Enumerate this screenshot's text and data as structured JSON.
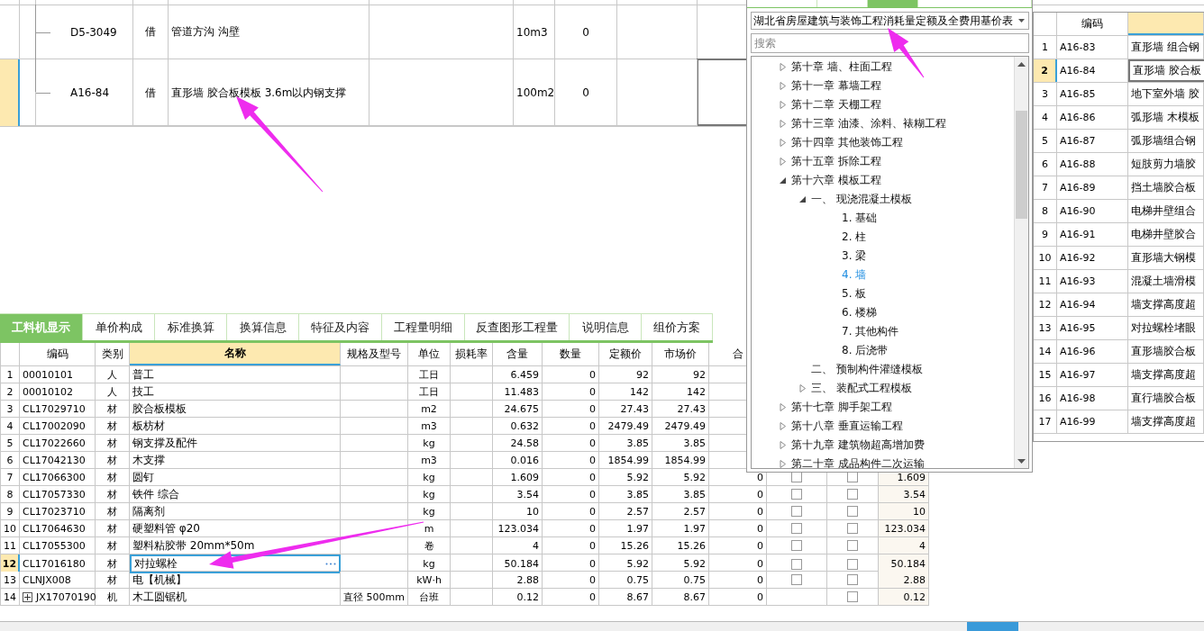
{
  "top_grid": {
    "rows": [
      {
        "code": "D5-3049",
        "type": "借",
        "name": "管道方沟 沟壁",
        "unit": "10m3",
        "qty": "0",
        "selected": false
      },
      {
        "code": "A16-84",
        "type": "借",
        "name": "直形墙 胶合板模板 3.6m以内钢支撑",
        "unit": "100m2",
        "qty": "0",
        "selected": true
      }
    ]
  },
  "tabs": [
    {
      "label": "工料机显示",
      "selected": true
    },
    {
      "label": "单价构成",
      "selected": false
    },
    {
      "label": "标准换算",
      "selected": false
    },
    {
      "label": "换算信息",
      "selected": false
    },
    {
      "label": "特征及内容",
      "selected": false
    },
    {
      "label": "工程量明细",
      "selected": false
    },
    {
      "label": "反查图形工程量",
      "selected": false
    },
    {
      "label": "说明信息",
      "selected": false
    },
    {
      "label": "组价方案",
      "selected": false
    }
  ],
  "resource_grid": {
    "columns": [
      "编码",
      "类别",
      "名称",
      "规格及型号",
      "单位",
      "损耗率",
      "含量",
      "数量",
      "定额价",
      "市场价",
      "合"
    ],
    "rows": [
      {
        "num": "1",
        "code": "00010101",
        "type": "人",
        "name": "普工",
        "unit": "工日",
        "amount": "6.459",
        "qty": "0",
        "quota_price": "92",
        "market_price": "92",
        "selected": false
      },
      {
        "num": "2",
        "code": "00010102",
        "type": "人",
        "name": "技工",
        "unit": "工日",
        "amount": "11.483",
        "qty": "0",
        "quota_price": "142",
        "market_price": "142",
        "selected": false
      },
      {
        "num": "3",
        "code": "CL17029710",
        "type": "材",
        "name": "胶合板模板",
        "unit": "m2",
        "amount": "24.675",
        "qty": "0",
        "quota_price": "27.43",
        "market_price": "27.43",
        "selected": false
      },
      {
        "num": "4",
        "code": "CL17002090",
        "type": "材",
        "name": "板枋材",
        "unit": "m3",
        "amount": "0.632",
        "qty": "0",
        "quota_price": "2479.49",
        "market_price": "2479.49",
        "selected": false
      },
      {
        "num": "5",
        "code": "CL17022660",
        "type": "材",
        "name": "钢支撑及配件",
        "unit": "kg",
        "amount": "24.58",
        "qty": "0",
        "quota_price": "3.85",
        "market_price": "3.85",
        "selected": false
      },
      {
        "num": "6",
        "code": "CL17042130",
        "type": "材",
        "name": "木支撑",
        "unit": "m3",
        "amount": "0.016",
        "qty": "0",
        "quota_price": "1854.99",
        "market_price": "1854.99",
        "selected": false
      },
      {
        "num": "7",
        "code": "CL17066300",
        "type": "材",
        "name": "圆钉",
        "unit": "kg",
        "amount": "1.609",
        "qty": "0",
        "quota_price": "5.92",
        "market_price": "5.92",
        "column_12": "0",
        "column_13_checked": false,
        "column_14_checked": false,
        "column_15": "1.609",
        "selected": false
      },
      {
        "num": "8",
        "code": "CL17057330",
        "type": "材",
        "name": "铁件 综合",
        "unit": "kg",
        "amount": "3.54",
        "qty": "0",
        "quota_price": "3.85",
        "market_price": "3.85",
        "column_12": "0",
        "column_13_checked": false,
        "column_14_checked": false,
        "column_15": "3.54",
        "selected": false
      },
      {
        "num": "9",
        "code": "CL17023710",
        "type": "材",
        "name": "隔离剂",
        "unit": "kg",
        "amount": "10",
        "qty": "0",
        "quota_price": "2.57",
        "market_price": "2.57",
        "column_12": "0",
        "column_13_checked": false,
        "column_14_checked": false,
        "column_15": "10",
        "selected": false
      },
      {
        "num": "10",
        "code": "CL17064630",
        "type": "材",
        "name": "硬塑料管 φ20",
        "unit": "m",
        "amount": "123.034",
        "qty": "0",
        "quota_price": "1.97",
        "market_price": "1.97",
        "column_12": "0",
        "column_13_checked": false,
        "column_14_checked": false,
        "column_15": "123.034",
        "selected": false
      },
      {
        "num": "11",
        "code": "CL17055300",
        "type": "材",
        "name": "塑料粘胶带 20mm*50m",
        "unit": "卷",
        "amount": "4",
        "qty": "0",
        "quota_price": "15.26",
        "market_price": "15.26",
        "column_12": "0",
        "column_13_checked": false,
        "column_14_checked": false,
        "column_15": "4",
        "selected": false
      },
      {
        "num": "12",
        "code": "CL17016180",
        "type": "材",
        "name": "对拉螺栓",
        "unit": "kg",
        "amount": "50.184",
        "qty": "0",
        "quota_price": "5.92",
        "market_price": "5.92",
        "column_12": "0",
        "column_13_checked": false,
        "column_14_checked": false,
        "column_15": "50.184",
        "selected": true
      },
      {
        "num": "13",
        "code": "CLNJX008",
        "type": "材",
        "name": "电【机械】",
        "unit": "kW·h",
        "amount": "2.88",
        "qty": "0",
        "quota_price": "0.75",
        "market_price": "0.75",
        "column_12": "0",
        "column_13_checked": false,
        "column_14_checked": false,
        "column_15": "2.88",
        "selected": false
      },
      {
        "num": "14",
        "code": "JX17070190",
        "type": "机",
        "name": "木工圆锯机",
        "spec": "直径 500mm",
        "unit": "台班",
        "amount": "0.12",
        "qty": "0",
        "quota_price": "8.67",
        "market_price": "8.67",
        "column_12": "0",
        "column_14_checked": false,
        "column_15": "0.12",
        "expanded": false,
        "selected": false
      }
    ]
  },
  "library_panel": {
    "dropdown": {
      "value": "湖北省房屋建筑与装饰工程消耗量定额及全费用基价表"
    },
    "search": {
      "placeholder": "搜索"
    },
    "tree": [
      {
        "label": "第十章 墙、柱面工程",
        "expanded": false,
        "selected": false
      },
      {
        "label": "第十一章 幕墙工程",
        "expanded": false,
        "selected": false
      },
      {
        "label": "第十二章 天棚工程",
        "expanded": false,
        "selected": false
      },
      {
        "label": "第十三章 油漆、涂料、裱糊工程",
        "expanded": false,
        "selected": false
      },
      {
        "label": "第十四章 其他装饰工程",
        "expanded": false,
        "selected": false
      },
      {
        "label": "第十五章 拆除工程",
        "expanded": false,
        "selected": false
      },
      {
        "label": "第十六章 模板工程",
        "expanded": true,
        "selected": false,
        "children": [
          {
            "label": "一、 现浇混凝土模板",
            "expanded": true,
            "selected": false,
            "children": [
              {
                "label": "1. 基础",
                "selected": false
              },
              {
                "label": "2. 柱",
                "selected": false
              },
              {
                "label": "3. 梁",
                "selected": false
              },
              {
                "label": "4. 墙",
                "selected": true
              },
              {
                "label": "5. 板",
                "selected": false
              },
              {
                "label": "6. 楼梯",
                "selected": false
              },
              {
                "label": "7. 其他构件",
                "selected": false
              },
              {
                "label": "8. 后浇带",
                "selected": false
              }
            ]
          },
          {
            "label": "二、 预制构件灌缝模板",
            "selected": false
          },
          {
            "label": "三、 装配式工程模板",
            "expanded": false,
            "selected": false
          }
        ]
      },
      {
        "label": "第十七章 脚手架工程",
        "expanded": false,
        "selected": false
      },
      {
        "label": "第十八章 垂直运输工程",
        "expanded": false,
        "selected": false
      },
      {
        "label": "第十九章 建筑物超高增加费",
        "expanded": false,
        "selected": false
      },
      {
        "label": "第二十章 成品构件二次运输",
        "expanded": false,
        "selected": false
      }
    ],
    "quota_table": {
      "columns": [
        "编码"
      ],
      "rows": [
        {
          "num": "1",
          "code": "A16-83",
          "name": "直形墙 组合钢",
          "selected": false
        },
        {
          "num": "2",
          "code": "A16-84",
          "name": "直形墙 胶合板",
          "selected": true
        },
        {
          "num": "3",
          "code": "A16-85",
          "name": "地下室外墙 胶",
          "selected": false
        },
        {
          "num": "4",
          "code": "A16-86",
          "name": "弧形墙 木模板",
          "selected": false
        },
        {
          "num": "5",
          "code": "A16-87",
          "name": "弧形墙组合钢",
          "selected": false
        },
        {
          "num": "6",
          "code": "A16-88",
          "name": "短肢剪力墙胶",
          "selected": false
        },
        {
          "num": "7",
          "code": "A16-89",
          "name": "挡土墙胶合板",
          "selected": false
        },
        {
          "num": "8",
          "code": "A16-90",
          "name": "电梯井壁组合",
          "selected": false
        },
        {
          "num": "9",
          "code": "A16-91",
          "name": "电梯井壁胶合",
          "selected": false
        },
        {
          "num": "10",
          "code": "A16-92",
          "name": "直形墙大钢模",
          "selected": false
        },
        {
          "num": "11",
          "code": "A16-93",
          "name": "混凝土墙滑模",
          "selected": false
        },
        {
          "num": "12",
          "code": "A16-94",
          "name": "墙支撑高度超",
          "selected": false
        },
        {
          "num": "13",
          "code": "A16-95",
          "name": "对拉螺栓堵眼",
          "selected": false
        },
        {
          "num": "14",
          "code": "A16-96",
          "name": "直形墙胶合板",
          "selected": false
        },
        {
          "num": "15",
          "code": "A16-97",
          "name": "墙支撑高度超",
          "selected": false
        },
        {
          "num": "16",
          "code": "A16-98",
          "name": "直行墙胶合板",
          "selected": false
        },
        {
          "num": "17",
          "code": "A16-99",
          "name": "墙支撑高度超",
          "selected": false
        }
      ]
    }
  }
}
